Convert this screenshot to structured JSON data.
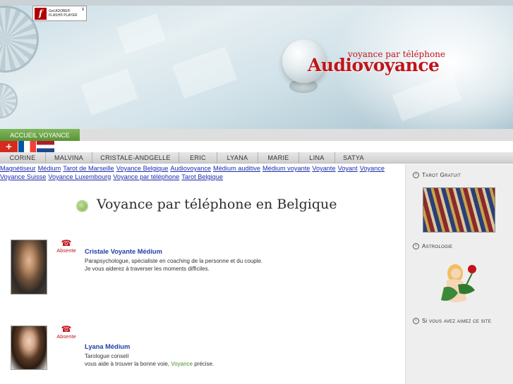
{
  "header": {
    "flash_badge": {
      "line1": "Get ADOBE®",
      "line2": "FLASH® PLAYER",
      "icon": "flash-icon",
      "icon_glyph": "f"
    },
    "logo_tagline": "voyance par téléphone",
    "logo_brand": "Audiovoyance"
  },
  "nav": {
    "home_tab": "ACCUEIL VOYANCE",
    "languages": [
      {
        "code": "ch",
        "icon": "swiss-flag-icon"
      },
      {
        "code": "fr",
        "icon": "french-flag-icon"
      },
      {
        "code": "nl",
        "icon": "dutch-flag-icon"
      }
    ],
    "names": [
      "CORINE",
      "MALVINA",
      "CRISTALE-ANDGELLE",
      "ERIC",
      "LYANA",
      "MARIE",
      "LINA",
      "SATYA"
    ]
  },
  "keywords": [
    "Magnétiseur",
    "Médium",
    "Tarot de Marseille",
    "Voyance Belgique",
    "Audiovoyance",
    "Médium auditive",
    "Médium voyante",
    "Voyante",
    "Voyant",
    "Voyance",
    "Voyance Suisse",
    "Voyance Luxembourg",
    "Voyance par téléphone",
    "Tarot Belgique"
  ],
  "main": {
    "title": "Voyance par téléphone en Belgique",
    "listings": [
      {
        "status": "Absente",
        "name": "Cristale Voyante Médium",
        "desc1": "Parapsychologue, spécialiste en coaching de la personne et du couple.",
        "desc2": "Je vous aiderez à traverser les moments difficiles.",
        "desc2_highlight": "",
        "desc2_after": ""
      },
      {
        "status": "Absente",
        "name": "Lyana Médium",
        "desc1": "Tarologue conseil",
        "desc2": "vous aide à trouver la bonne voie, ",
        "desc2_highlight": "Voyance",
        "desc2_after": " précise."
      }
    ]
  },
  "sidebar": {
    "sections": [
      {
        "title": "Tarot Gratuit"
      },
      {
        "title": "Astrologie"
      },
      {
        "title": "Si vous avez aimez ce site"
      }
    ]
  },
  "colors": {
    "brand_red": "#c0141a",
    "nav_green": "#5b9438",
    "link_blue": "#1a2eb0"
  }
}
